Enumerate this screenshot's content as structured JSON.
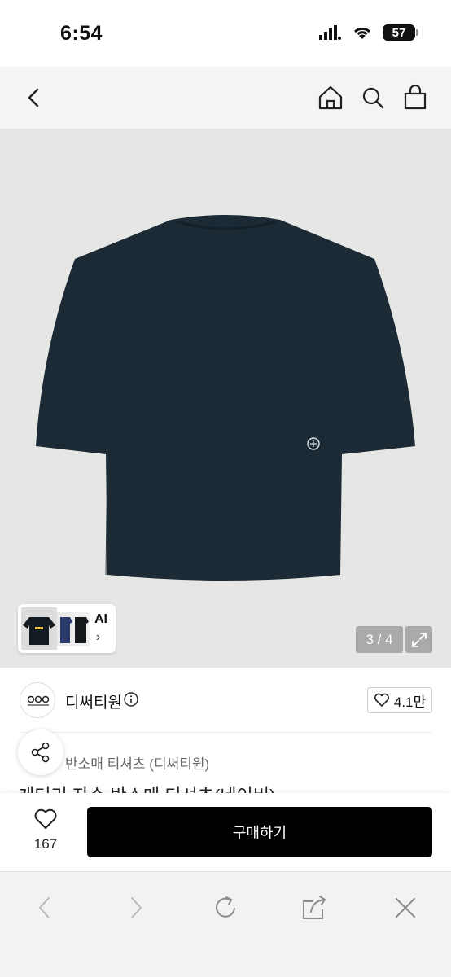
{
  "status": {
    "time": "6:54",
    "battery": "57"
  },
  "nav": {
    "back": "back-icon",
    "icons": [
      "home-icon",
      "search-icon",
      "shopping-bag-icon"
    ]
  },
  "hero": {
    "ai_label": "AI",
    "page_indicator": "3 / 4",
    "current_page": 3,
    "total_pages": 4
  },
  "brand": {
    "name": "디써티원",
    "likes": "4.1만"
  },
  "product": {
    "category_visible": "반소매 티셔츠 (디써티원)",
    "title_partial": "케더리 자수 반소매 티셔츠(네이비)"
  },
  "purchase": {
    "wish_count": "167",
    "buy_label": "구매하기"
  },
  "colors": {
    "shirt": "#1b2a35",
    "hero_bg": "#e6e6e4",
    "buy_button": "#000000"
  }
}
